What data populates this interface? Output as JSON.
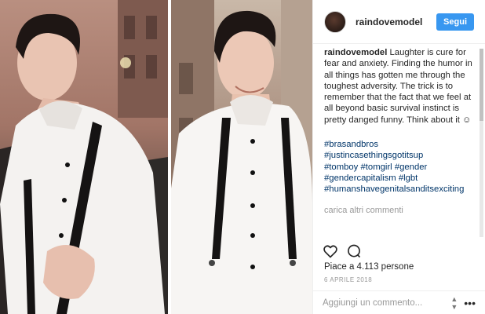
{
  "header": {
    "username": "raindovemodel",
    "follow_label": "Segui"
  },
  "caption": {
    "username": "raindovemodel",
    "text": " Laughter is cure for fear and anxiety. Finding the humor in all things has gotten me through the toughest adversity. The trick is to remember that the fact that we feel at all beyond basic survival instinct is pretty danged funny. Think about it ☺",
    "hashtags": [
      "#brasandbros",
      "#justincasethingsgotitsup",
      "#tomboy",
      "#tomgirl",
      "#gender",
      "#gendercapitalism",
      "#lgbt",
      "#humanshavegenitalsanditsexciting"
    ]
  },
  "load_more": "carica altri commenti",
  "likes": "Piace a 4.113 persone",
  "date": "6 APRILE 2018",
  "comment": {
    "placeholder": "Aggiungi un commento..."
  },
  "icons": {
    "like": "heart-icon",
    "comment": "comment-icon",
    "options": "more-options-icon"
  },
  "colors": {
    "follow_button": "#3897f0",
    "hashtag": "#003569",
    "muted": "#999999"
  }
}
